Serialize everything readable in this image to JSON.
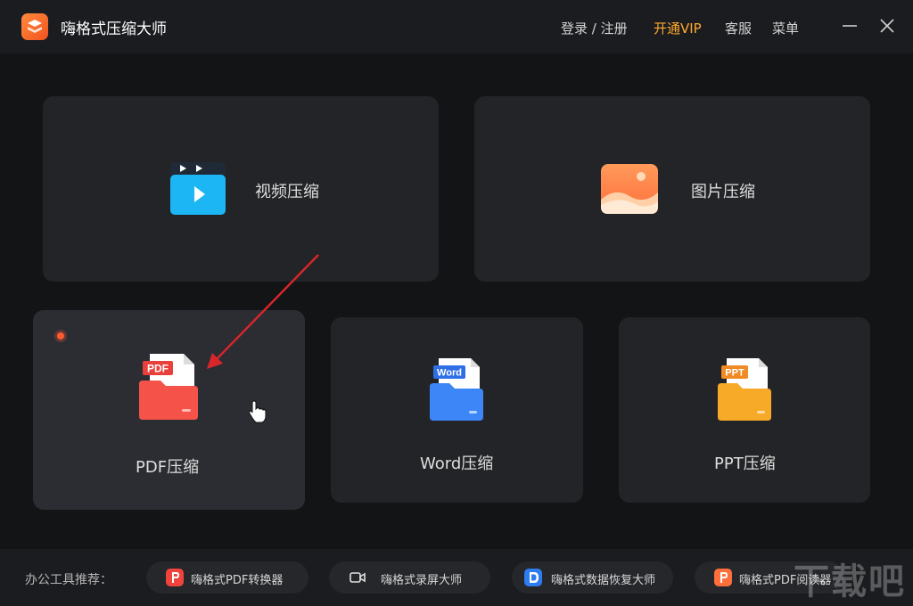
{
  "app": {
    "title": "嗨格式压缩大师"
  },
  "header": {
    "login": "登录 / 注册",
    "vip": "开通VIP",
    "service": "客服",
    "menu": "菜单"
  },
  "cards": {
    "video": {
      "label": "视频压缩",
      "icon": "video-clapper-icon"
    },
    "image": {
      "label": "图片压缩",
      "icon": "image-icon"
    },
    "pdf": {
      "label": "PDF压缩",
      "icon": "pdf-folder-icon",
      "tag": "PDF"
    },
    "word": {
      "label": "Word压缩",
      "icon": "word-folder-icon",
      "tag": "Word"
    },
    "ppt": {
      "label": "PPT压缩",
      "icon": "ppt-folder-icon",
      "tag": "PPT"
    }
  },
  "footer": {
    "label": "办公工具推荐：",
    "recommendations": [
      {
        "label": "嗨格式PDF转换器",
        "icon": "pdf-converter-icon"
      },
      {
        "label": "嗨格式录屏大师",
        "icon": "screen-recorder-icon"
      },
      {
        "label": "嗨格式数据恢复大师",
        "icon": "data-recovery-icon"
      },
      {
        "label": "嗨格式PDF阅读器",
        "icon": "pdf-reader-icon"
      }
    ]
  },
  "watermark": "下载吧",
  "colors": {
    "vip": "#ffa92e",
    "accent": "#f2531f",
    "pdf": "#f5534a",
    "word": "#2f7cf6",
    "ppt": "#f5a623"
  }
}
